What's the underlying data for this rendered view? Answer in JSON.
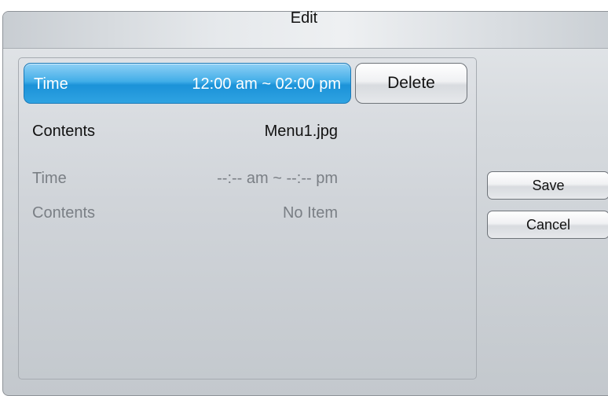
{
  "dialog": {
    "title": "Edit"
  },
  "schedule": {
    "entries": [
      {
        "time_label": "Time",
        "time_value": "12:00 am ~ 02:00 pm",
        "contents_label": "Contents",
        "contents_value": "Menu1.jpg",
        "selected": true
      },
      {
        "time_label": "Time",
        "time_value": "--:-- am ~ --:-- pm",
        "contents_label": "Contents",
        "contents_value": "No Item",
        "selected": false
      }
    ]
  },
  "buttons": {
    "delete": "Delete",
    "save": "Save",
    "cancel": "Cancel"
  },
  "colors": {
    "selection": "#2fa3e2",
    "dim_text": "#7a7f85"
  }
}
